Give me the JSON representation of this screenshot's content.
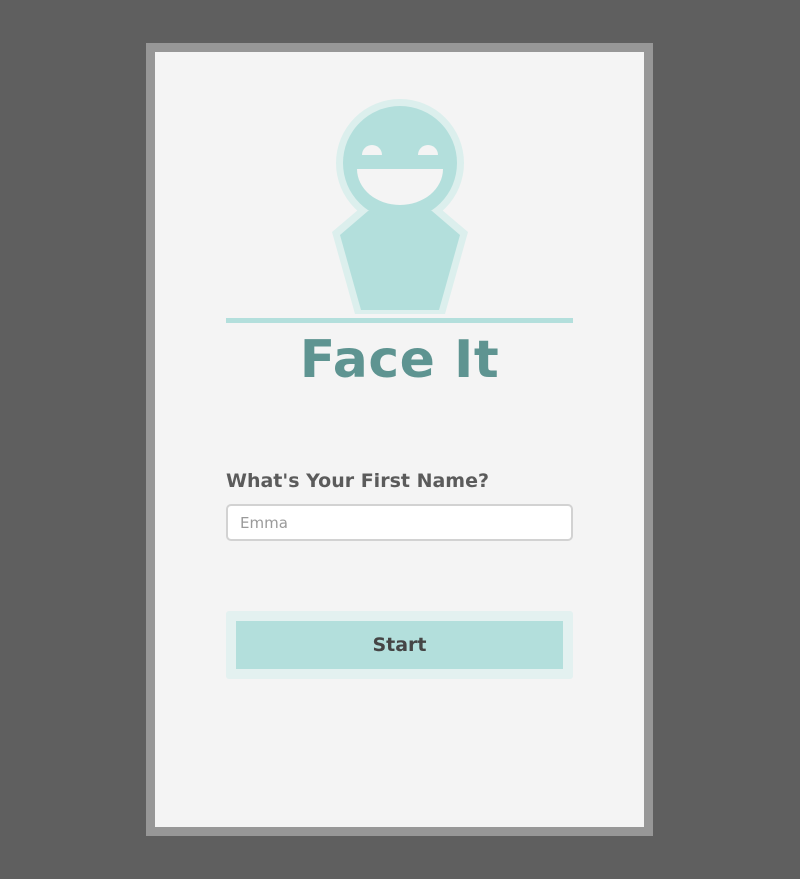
{
  "app": {
    "title": "Face It"
  },
  "form": {
    "name_label": "What's Your First Name?",
    "name_placeholder": "Emma",
    "name_value": "",
    "start_label": "Start"
  },
  "icons": {
    "mascot": "smiling-person-icon"
  },
  "colors": {
    "background": "#5f5f5f",
    "frame": "#979797",
    "screen": "#f4f4f4",
    "accent": "#b3dfdc",
    "accent_light": "#e3f1f0",
    "title": "#5e9491",
    "label": "#5b5b5b"
  }
}
